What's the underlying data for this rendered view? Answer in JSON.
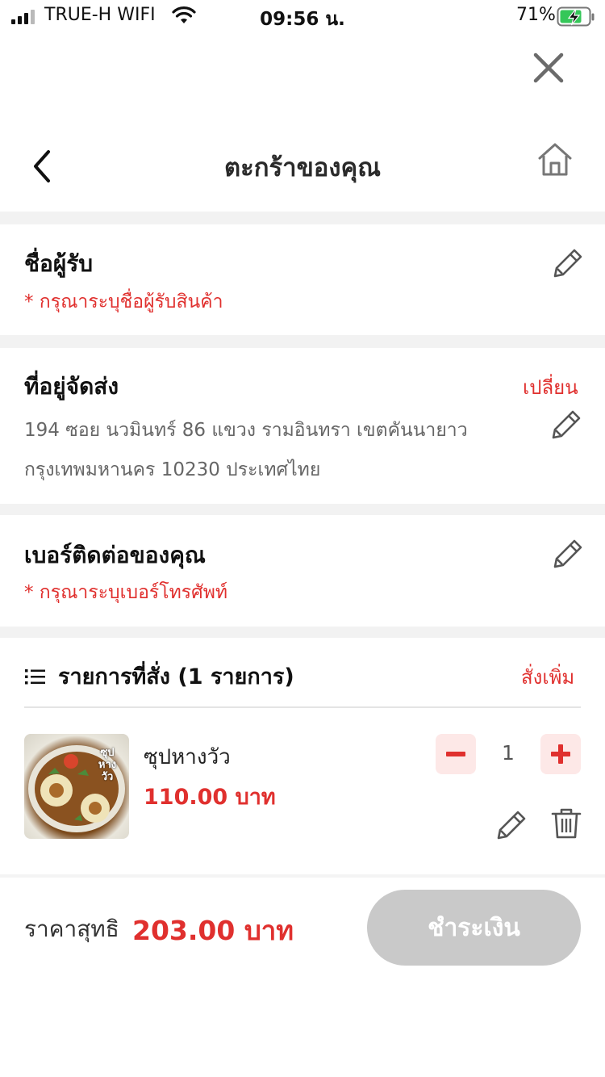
{
  "status_bar": {
    "carrier": "TRUE-H WIFI",
    "time": "09:56 น.",
    "battery_percent": "71%"
  },
  "nav": {
    "title": "ตะกร้าของคุณ"
  },
  "recipient": {
    "title": "ชื่อผู้รับ",
    "hint": "* กรุณาระบุชื่อผู้รับสินค้า"
  },
  "address": {
    "title": "ที่อยู่จัดส่ง",
    "change_label": "เปลี่ยน",
    "line1": "194 ซอย นวมินทร์ 86 แขวง รามอินทรา เขตคันนายาว",
    "line2": "กรุงเทพมหานคร 10230 ประเทศไทย"
  },
  "phone": {
    "title": "เบอร์ติดต่อของคุณ",
    "hint": "* กรุณาระบุเบอร์โทรศัพท์"
  },
  "orders": {
    "title": "รายการที่สั่ง (1 รายการ)",
    "add_more_label": "สั่งเพิ่ม",
    "items": [
      {
        "name": "ซุปหางวัว",
        "price": "110.00 บาท",
        "quantity": "1",
        "image_caption": "ซุป หาง วัว"
      }
    ]
  },
  "footer": {
    "total_label": "ราคาสุทธิ",
    "total_value": "203.00 บาท",
    "pay_label": "ชำระเงิน"
  },
  "colors": {
    "accent_red": "#e0302e",
    "qty_button_bg": "#fde8e7",
    "pay_button_disabled": "#c9c9c9",
    "section_separator": "#f2f2f2"
  },
  "icons": {
    "close": "close-icon",
    "back": "chevron-left-icon",
    "home": "home-icon",
    "edit": "pencil-icon",
    "list": "list-icon",
    "minus": "minus-icon",
    "plus": "plus-icon",
    "delete": "trash-icon"
  }
}
